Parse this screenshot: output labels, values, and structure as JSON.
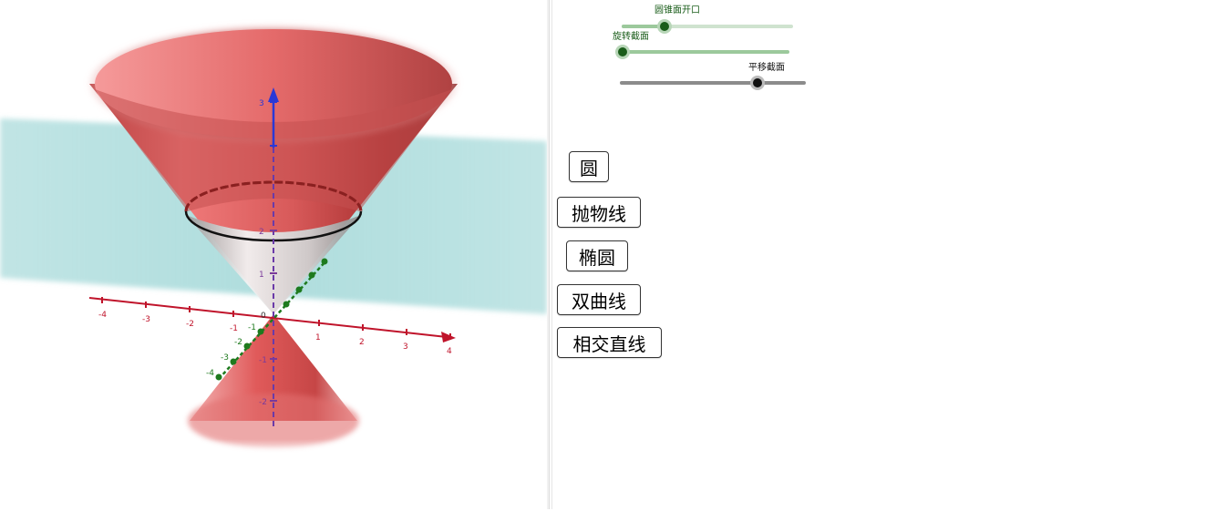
{
  "graphics": {
    "x_ticks": [
      "-4",
      "-3",
      "-2",
      "-1",
      "1",
      "2",
      "3",
      "4"
    ],
    "y_ticks": [
      "-4",
      "-3",
      "-2",
      "-1"
    ],
    "z_ticks": [
      "3",
      "2",
      "1",
      "-1",
      "-2"
    ],
    "origin": "0",
    "colors": {
      "cone": "#e04848",
      "plane": "#9fd6d6",
      "x_axis": "#c0142b",
      "y_axis": "#1e7a1e",
      "z_axis": "#2b38d6"
    }
  },
  "sliders": [
    {
      "label": "圆锥面开口",
      "color": "#1a5d1a",
      "value": 0.25
    },
    {
      "label": "旋转截面",
      "color": "#1a5d1a",
      "value": 0.0
    },
    {
      "label": "平移截面",
      "color": "#111111",
      "value": 0.74
    }
  ],
  "buttons": {
    "circle": "圆",
    "parabola": "抛物线",
    "ellipse": "椭圆",
    "hyperbola": "双曲线",
    "intersecting_lines": "相交直线"
  }
}
